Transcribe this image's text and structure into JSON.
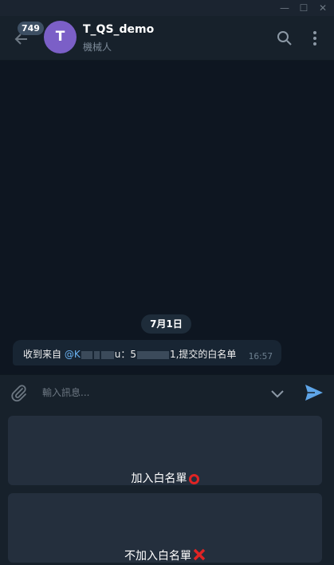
{
  "header": {
    "unread_badge": "749",
    "avatar_letter": "T",
    "title": "T_QS_demo",
    "subtitle": "機械人"
  },
  "chat": {
    "date_label": "7月1日",
    "message": {
      "prefix": "收到来自",
      "mention": "@K",
      "mid1": "u：5",
      "suffix": "1,提交的白名单",
      "time": "16:57"
    }
  },
  "composer": {
    "placeholder": "輸入訊息..."
  },
  "keyboard": {
    "buttons": [
      {
        "label": "加入白名單"
      },
      {
        "label": "不加入白名單"
      }
    ]
  },
  "colors": {
    "accent": "#5ea5e8",
    "background": "#0e1621",
    "panel": "#17212b",
    "button": "#242f3d"
  }
}
